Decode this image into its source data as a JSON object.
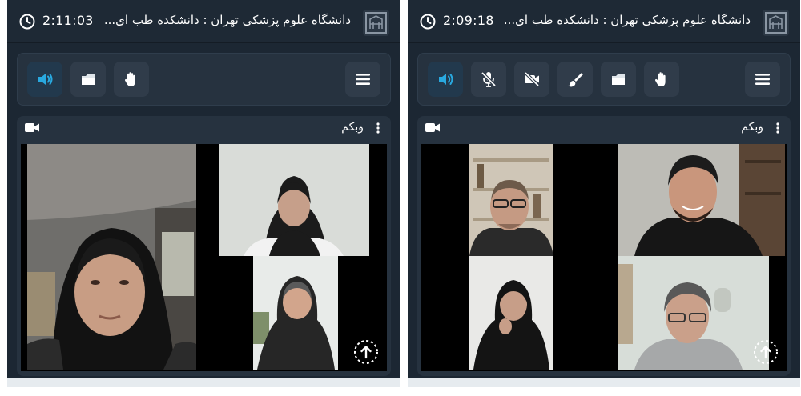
{
  "colors": {
    "app_bg": "#1c2733",
    "panel_bg": "#26323f",
    "button_bg": "#303c4a",
    "accent_blue": "#29a9e0",
    "text": "#ffffff"
  },
  "screens": [
    {
      "timer": "2:11:03",
      "title": "دانشگاه علوم پزشکی تهران : دانشکده طب ای...",
      "toolbar_buttons": [
        "speaker-icon",
        "folder-icon",
        "raise-hand-icon"
      ],
      "panel_title": "وبکم"
    },
    {
      "timer": "2:09:18",
      "title": "دانشگاه علوم پزشکی تهران : دانشکده طب ای...",
      "toolbar_buttons": [
        "speaker-icon",
        "mic-muted-icon",
        "camera-off-icon",
        "brush-icon",
        "folder-icon",
        "raise-hand-icon"
      ],
      "panel_title": "وبکم"
    }
  ]
}
